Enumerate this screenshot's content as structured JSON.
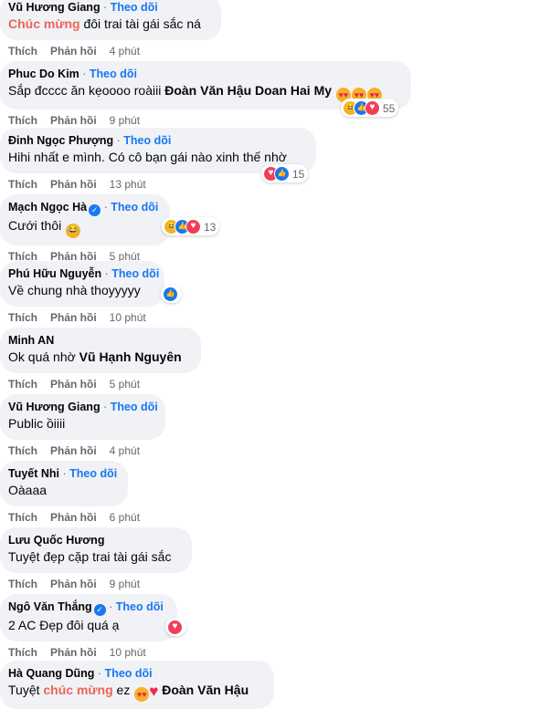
{
  "comments": [
    {
      "name": "Vũ Hương Giang",
      "verified": false,
      "follow": "Theo dõi",
      "text": [
        {
          "t": "hl",
          "v": "Chúc mừng"
        },
        {
          "t": "plain",
          "v": " đôi trai tài gái sắc ná"
        }
      ],
      "reactions": null,
      "actions": {
        "like": "Thích",
        "reply": "Phản hồi",
        "time": "4 phút"
      }
    },
    {
      "name": "Phuc Do Kim",
      "verified": false,
      "follow": "Theo dõi",
      "text": [
        {
          "t": "plain",
          "v": "Sắp đcccc ăn kẹoooo roàiii "
        },
        {
          "t": "mention",
          "v": "Đoàn Văn Hậu"
        },
        {
          "t": "plain",
          "v": " "
        },
        {
          "t": "mention",
          "v": "Doan Hai My"
        },
        {
          "t": "plain",
          "v": " "
        },
        {
          "t": "emoji",
          "v": "heart-eyes-emoji"
        },
        {
          "t": "emoji",
          "v": "heart-eyes-emoji"
        },
        {
          "t": "emoji",
          "v": "heart-eyes-emoji"
        }
      ],
      "reactions": {
        "icons": [
          "haha",
          "like",
          "love"
        ],
        "count": "55"
      },
      "actions": {
        "like": "Thích",
        "reply": "Phản hồi",
        "time": "9 phút"
      }
    },
    {
      "name": "Đinh Ngọc Phượng",
      "verified": false,
      "follow": "Theo dõi",
      "text": [
        {
          "t": "plain",
          "v": "Hihi nhất e mình. Có cô bạn gái nào xinh thế nhờ"
        }
      ],
      "reactions": {
        "icons": [
          "love",
          "like"
        ],
        "count": "15"
      },
      "actions": {
        "like": "Thích",
        "reply": "Phản hồi",
        "time": "13 phút"
      }
    },
    {
      "name": "Mạch Ngọc Hà",
      "verified": true,
      "follow": "Theo dõi",
      "text": [
        {
          "t": "plain",
          "v": "Cưới thôi "
        },
        {
          "t": "emoji",
          "v": "laughing-emoji"
        }
      ],
      "reactions": {
        "icons": [
          "haha",
          "like",
          "love"
        ],
        "count": "13"
      },
      "actions": {
        "like": "Thích",
        "reply": "Phản hồi",
        "time": "5 phút"
      }
    },
    {
      "name": "Phú Hữu Nguyễn",
      "verified": false,
      "follow": "Theo dõi",
      "text": [
        {
          "t": "plain",
          "v": "Về chung nhà thoyyyyy"
        }
      ],
      "reactions": {
        "icons": [
          "like"
        ],
        "count": ""
      },
      "actions": {
        "like": "Thích",
        "reply": "Phản hồi",
        "time": "10 phút"
      }
    },
    {
      "name": "Minh AN",
      "verified": false,
      "follow": "",
      "text": [
        {
          "t": "plain",
          "v": "Ok quá nhờ "
        },
        {
          "t": "mention",
          "v": "Vũ Hạnh Nguyên"
        }
      ],
      "reactions": null,
      "actions": {
        "like": "Thích",
        "reply": "Phản hồi",
        "time": "5 phút"
      }
    },
    {
      "name": "Vũ Hương Giang",
      "verified": false,
      "follow": "Theo dõi",
      "text": [
        {
          "t": "plain",
          "v": "Public ồiiii"
        }
      ],
      "reactions": null,
      "actions": {
        "like": "Thích",
        "reply": "Phản hồi",
        "time": "4 phút"
      }
    },
    {
      "name": "Tuyết Nhi",
      "verified": false,
      "follow": "Theo dõi",
      "text": [
        {
          "t": "plain",
          "v": "Oàaaa"
        }
      ],
      "reactions": null,
      "actions": {
        "like": "Thích",
        "reply": "Phản hồi",
        "time": "6 phút"
      }
    },
    {
      "name": "Lưu Quốc Hương",
      "verified": false,
      "follow": "",
      "text": [
        {
          "t": "plain",
          "v": "Tuyệt đẹp cặp trai tài gái sắc"
        }
      ],
      "reactions": null,
      "actions": {
        "like": "Thích",
        "reply": "Phản hồi",
        "time": "9 phút"
      }
    },
    {
      "name": "Ngô Văn Thắng",
      "verified": true,
      "follow": "Theo dõi",
      "text": [
        {
          "t": "plain",
          "v": "2 AC Đẹp đôi quá ạ"
        }
      ],
      "reactions": {
        "icons": [
          "love"
        ],
        "count": ""
      },
      "actions": {
        "like": "Thích",
        "reply": "Phản hồi",
        "time": "10 phút"
      }
    },
    {
      "name": "Hà Quang Dũng",
      "verified": false,
      "follow": "Theo dõi",
      "text": [
        {
          "t": "plain",
          "v": "Tuyệt "
        },
        {
          "t": "hl",
          "v": "chúc mừng"
        },
        {
          "t": "plain",
          "v": " ez "
        },
        {
          "t": "emoji",
          "v": "heart-eyes-emoji"
        },
        {
          "t": "heart",
          "v": "red-heart-emoji"
        },
        {
          "t": "plain",
          "v": " "
        },
        {
          "t": "mention",
          "v": "Đoàn Văn Hậu"
        }
      ],
      "reactions": null,
      "actions": null
    }
  ]
}
